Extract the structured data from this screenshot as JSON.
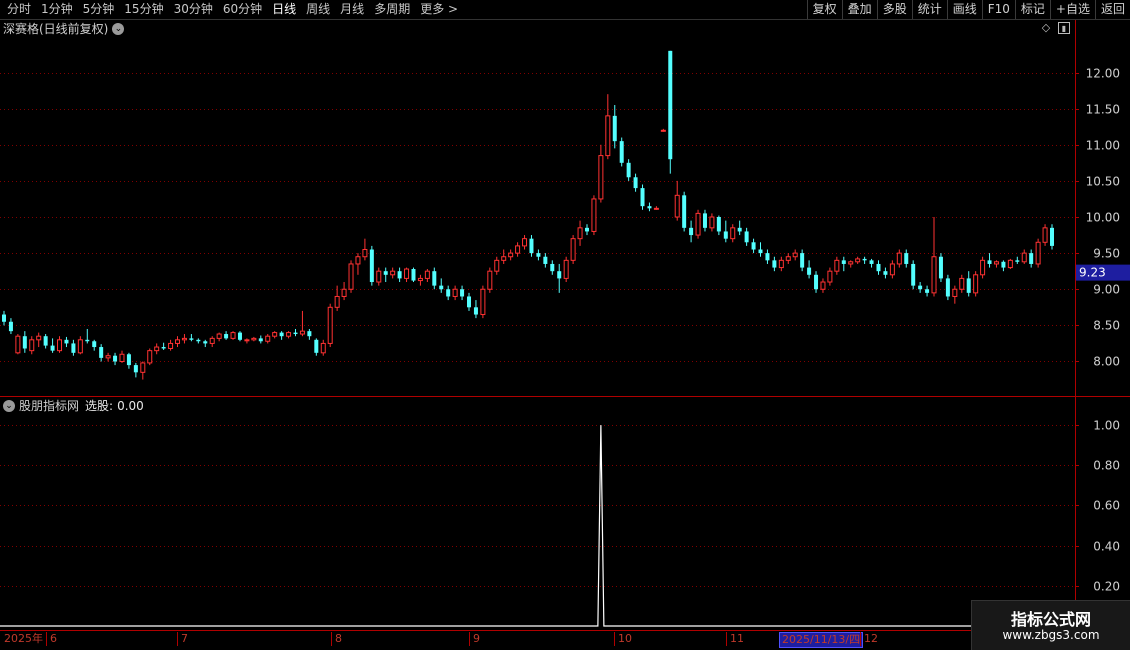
{
  "toolbar": {
    "periods": [
      "分时",
      "1分钟",
      "5分钟",
      "15分钟",
      "30分钟",
      "60分钟",
      "日线",
      "周线",
      "月线",
      "多周期",
      "更多 >"
    ],
    "active_period": 6,
    "tools": [
      "复权",
      "叠加",
      "多股",
      "统计",
      "画线",
      "F10",
      "标记",
      "+自选",
      "返回"
    ]
  },
  "main_panel": {
    "title": "深赛格(日线前复权)",
    "price_label": "9.23",
    "y_ticks": [
      "12.00",
      "11.50",
      "11.00",
      "10.50",
      "10.00",
      "9.50",
      "9.00",
      "8.50",
      "8.00"
    ]
  },
  "indicator_panel": {
    "name": "股朋指标网",
    "series_label": "选股:",
    "series_value": "0.00",
    "y_ticks": [
      "1.00",
      "0.80",
      "0.60",
      "0.40",
      "0.20"
    ]
  },
  "time_axis": {
    "labels": [
      "2025年",
      "6",
      "7",
      "8",
      "9",
      "10",
      "11",
      "12"
    ],
    "cursor_date": "2025/11/13/四"
  },
  "watermark": {
    "name": "指标公式网",
    "url": "www.zbgs3.com"
  },
  "colors": {
    "up": "#ff3232",
    "down": "#54ffff",
    "grid": "#800000",
    "axis": "#b00000",
    "price_label_bg": "#1e1ea0"
  },
  "chart_data": [
    {
      "type": "candlestick",
      "title": "深赛格(日线前复权)",
      "ylim": [
        7.55,
        12.45
      ],
      "y_ticks": [
        12.0,
        11.5,
        11.0,
        10.5,
        10.0,
        9.5,
        9.0,
        8.5,
        8.0
      ],
      "last_price": 9.23,
      "candles": [
        [
          8.65,
          8.7,
          8.5,
          8.55
        ],
        [
          8.55,
          8.6,
          8.38,
          8.42
        ],
        [
          8.12,
          8.38,
          8.1,
          8.35
        ],
        [
          8.35,
          8.42,
          8.12,
          8.18
        ],
        [
          8.15,
          8.35,
          8.1,
          8.3
        ],
        [
          8.3,
          8.4,
          8.2,
          8.35
        ],
        [
          8.35,
          8.38,
          8.18,
          8.22
        ],
        [
          8.22,
          8.32,
          8.12,
          8.15
        ],
        [
          8.15,
          8.35,
          8.12,
          8.3
        ],
        [
          8.3,
          8.34,
          8.2,
          8.25
        ],
        [
          8.25,
          8.3,
          8.08,
          8.12
        ],
        [
          8.12,
          8.35,
          8.1,
          8.3
        ],
        [
          8.3,
          8.45,
          8.25,
          8.28
        ],
        [
          8.28,
          8.3,
          8.15,
          8.2
        ],
        [
          8.2,
          8.24,
          8.0,
          8.05
        ],
        [
          8.05,
          8.12,
          8.0,
          8.08
        ],
        [
          8.08,
          8.12,
          7.95,
          8.0
        ],
        [
          8.0,
          8.15,
          7.98,
          8.1
        ],
        [
          8.1,
          8.12,
          7.9,
          7.95
        ],
        [
          7.95,
          7.98,
          7.78,
          7.85
        ],
        [
          7.85,
          8.0,
          7.75,
          7.98
        ],
        [
          7.98,
          8.18,
          7.95,
          8.15
        ],
        [
          8.15,
          8.25,
          8.1,
          8.2
        ],
        [
          8.2,
          8.26,
          8.16,
          8.18
        ],
        [
          8.18,
          8.3,
          8.15,
          8.25
        ],
        [
          8.25,
          8.35,
          8.2,
          8.3
        ],
        [
          8.3,
          8.38,
          8.25,
          8.32
        ],
        [
          8.32,
          8.38,
          8.28,
          8.3
        ],
        [
          8.3,
          8.32,
          8.25,
          8.28
        ],
        [
          8.28,
          8.3,
          8.2,
          8.25
        ],
        [
          8.25,
          8.35,
          8.2,
          8.32
        ],
        [
          8.32,
          8.4,
          8.28,
          8.38
        ],
        [
          8.38,
          8.42,
          8.3,
          8.32
        ],
        [
          8.32,
          8.42,
          8.3,
          8.4
        ],
        [
          8.4,
          8.42,
          8.28,
          8.3
        ],
        [
          8.3,
          8.32,
          8.25,
          8.3
        ],
        [
          8.3,
          8.34,
          8.28,
          8.32
        ],
        [
          8.32,
          8.36,
          8.25,
          8.28
        ],
        [
          8.28,
          8.38,
          8.25,
          8.35
        ],
        [
          8.35,
          8.42,
          8.32,
          8.4
        ],
        [
          8.4,
          8.42,
          8.3,
          8.35
        ],
        [
          8.35,
          8.42,
          8.32,
          8.4
        ],
        [
          8.4,
          8.45,
          8.35,
          8.38
        ],
        [
          8.38,
          8.7,
          8.35,
          8.42
        ],
        [
          8.42,
          8.45,
          8.3,
          8.35
        ],
        [
          8.3,
          8.32,
          8.08,
          8.12
        ],
        [
          8.12,
          8.3,
          8.08,
          8.25
        ],
        [
          8.25,
          8.8,
          8.2,
          8.75
        ],
        [
          8.75,
          9.05,
          8.7,
          8.9
        ],
        [
          8.9,
          9.1,
          8.85,
          9.0
        ],
        [
          9.0,
          9.4,
          8.95,
          9.35
        ],
        [
          9.35,
          9.5,
          9.2,
          9.45
        ],
        [
          9.45,
          9.7,
          9.4,
          9.55
        ],
        [
          9.55,
          9.6,
          9.05,
          9.1
        ],
        [
          9.1,
          9.3,
          9.05,
          9.25
        ],
        [
          9.25,
          9.3,
          9.1,
          9.2
        ],
        [
          9.2,
          9.3,
          9.15,
          9.25
        ],
        [
          9.25,
          9.3,
          9.1,
          9.15
        ],
        [
          9.15,
          9.3,
          9.1,
          9.28
        ],
        [
          9.28,
          9.3,
          9.1,
          9.12
        ],
        [
          9.12,
          9.2,
          9.05,
          9.15
        ],
        [
          9.15,
          9.28,
          9.1,
          9.25
        ],
        [
          9.25,
          9.3,
          9.0,
          9.05
        ],
        [
          9.05,
          9.15,
          8.95,
          9.0
        ],
        [
          9.0,
          9.05,
          8.85,
          8.9
        ],
        [
          8.9,
          9.05,
          8.85,
          9.0
        ],
        [
          9.0,
          9.05,
          8.85,
          8.9
        ],
        [
          8.9,
          8.95,
          8.7,
          8.75
        ],
        [
          8.75,
          8.85,
          8.6,
          8.65
        ],
        [
          8.65,
          9.05,
          8.6,
          9.0
        ],
        [
          9.0,
          9.3,
          8.95,
          9.25
        ],
        [
          9.25,
          9.45,
          9.2,
          9.4
        ],
        [
          9.4,
          9.55,
          9.35,
          9.45
        ],
        [
          9.45,
          9.55,
          9.4,
          9.5
        ],
        [
          9.5,
          9.65,
          9.45,
          9.6
        ],
        [
          9.6,
          9.75,
          9.55,
          9.7
        ],
        [
          9.7,
          9.75,
          9.45,
          9.5
        ],
        [
          9.5,
          9.55,
          9.4,
          9.45
        ],
        [
          9.45,
          9.5,
          9.3,
          9.35
        ],
        [
          9.35,
          9.4,
          9.2,
          9.25
        ],
        [
          9.25,
          9.35,
          8.95,
          9.15
        ],
        [
          9.15,
          9.45,
          9.1,
          9.4
        ],
        [
          9.4,
          9.75,
          9.35,
          9.7
        ],
        [
          9.7,
          9.95,
          9.6,
          9.85
        ],
        [
          9.85,
          9.9,
          9.75,
          9.8
        ],
        [
          9.8,
          10.3,
          9.75,
          10.25
        ],
        [
          10.25,
          11.0,
          10.2,
          10.85
        ],
        [
          10.85,
          11.7,
          10.8,
          11.4
        ],
        [
          11.4,
          11.55,
          10.95,
          11.05
        ],
        [
          11.05,
          11.1,
          10.7,
          10.75
        ],
        [
          10.75,
          10.8,
          10.5,
          10.55
        ],
        [
          10.55,
          10.6,
          10.35,
          10.4
        ],
        [
          10.4,
          10.45,
          10.1,
          10.15
        ],
        [
          10.15,
          10.2,
          10.08,
          10.12
        ],
        [
          10.12,
          10.15,
          10.1,
          10.12
        ],
        [
          11.2,
          11.22,
          11.18,
          11.2
        ],
        [
          12.3,
          12.3,
          10.6,
          10.8
        ],
        [
          10.0,
          10.5,
          9.95,
          10.3
        ],
        [
          10.3,
          10.35,
          9.8,
          9.85
        ],
        [
          9.85,
          9.95,
          9.65,
          9.75
        ],
        [
          9.75,
          10.1,
          9.7,
          10.05
        ],
        [
          10.05,
          10.1,
          9.8,
          9.85
        ],
        [
          9.85,
          10.05,
          9.8,
          10.0
        ],
        [
          10.0,
          10.02,
          9.75,
          9.8
        ],
        [
          9.8,
          9.95,
          9.65,
          9.7
        ],
        [
          9.7,
          9.9,
          9.65,
          9.85
        ],
        [
          9.85,
          9.95,
          9.75,
          9.8
        ],
        [
          9.8,
          9.85,
          9.6,
          9.65
        ],
        [
          9.65,
          9.7,
          9.5,
          9.55
        ],
        [
          9.55,
          9.65,
          9.45,
          9.5
        ],
        [
          9.5,
          9.55,
          9.35,
          9.4
        ],
        [
          9.4,
          9.45,
          9.25,
          9.3
        ],
        [
          9.3,
          9.45,
          9.25,
          9.4
        ],
        [
          9.4,
          9.5,
          9.35,
          9.45
        ],
        [
          9.45,
          9.55,
          9.4,
          9.5
        ],
        [
          9.5,
          9.55,
          9.25,
          9.3
        ],
        [
          9.3,
          9.4,
          9.15,
          9.2
        ],
        [
          9.2,
          9.25,
          8.95,
          9.0
        ],
        [
          9.0,
          9.15,
          8.95,
          9.1
        ],
        [
          9.1,
          9.3,
          9.05,
          9.25
        ],
        [
          9.25,
          9.45,
          9.2,
          9.4
        ],
        [
          9.4,
          9.45,
          9.25,
          9.35
        ],
        [
          9.35,
          9.4,
          9.3,
          9.38
        ],
        [
          9.38,
          9.45,
          9.35,
          9.42
        ],
        [
          9.42,
          9.45,
          9.35,
          9.4
        ],
        [
          9.4,
          9.42,
          9.3,
          9.35
        ],
        [
          9.35,
          9.4,
          9.2,
          9.25
        ],
        [
          9.25,
          9.3,
          9.15,
          9.2
        ],
        [
          9.2,
          9.4,
          9.15,
          9.35
        ],
        [
          9.35,
          9.55,
          9.3,
          9.5
        ],
        [
          9.5,
          9.55,
          9.3,
          9.35
        ],
        [
          9.35,
          9.4,
          9.0,
          9.05
        ],
        [
          9.05,
          9.1,
          8.95,
          9.0
        ],
        [
          9.0,
          9.05,
          8.9,
          8.95
        ],
        [
          8.95,
          10.0,
          8.9,
          9.45
        ],
        [
          9.45,
          9.5,
          9.1,
          9.15
        ],
        [
          9.15,
          9.2,
          8.85,
          8.9
        ],
        [
          8.9,
          9.05,
          8.8,
          9.0
        ],
        [
          9.0,
          9.2,
          8.95,
          9.15
        ],
        [
          9.15,
          9.25,
          8.9,
          8.95
        ],
        [
          8.95,
          9.25,
          8.9,
          9.2
        ],
        [
          9.2,
          9.45,
          9.15,
          9.4
        ],
        [
          9.4,
          9.5,
          9.3,
          9.35
        ],
        [
          9.35,
          9.4,
          9.3,
          9.38
        ],
        [
          9.38,
          9.4,
          9.25,
          9.3
        ],
        [
          9.3,
          9.42,
          9.28,
          9.4
        ],
        [
          9.4,
          9.45,
          9.35,
          9.38
        ],
        [
          9.38,
          9.55,
          9.35,
          9.5
        ],
        [
          9.5,
          9.55,
          9.3,
          9.35
        ],
        [
          9.35,
          9.7,
          9.3,
          9.65
        ],
        [
          9.65,
          9.9,
          9.6,
          9.85
        ],
        [
          9.85,
          9.9,
          9.55,
          9.6
        ]
      ]
    },
    {
      "type": "line",
      "title": "股朋指标网",
      "series": [
        {
          "name": "选股",
          "value_label": "0.00"
        }
      ],
      "ylim": [
        0,
        1.1
      ],
      "y_ticks": [
        1.0,
        0.8,
        0.6,
        0.4,
        0.2
      ],
      "signals": [
        86
      ]
    }
  ]
}
